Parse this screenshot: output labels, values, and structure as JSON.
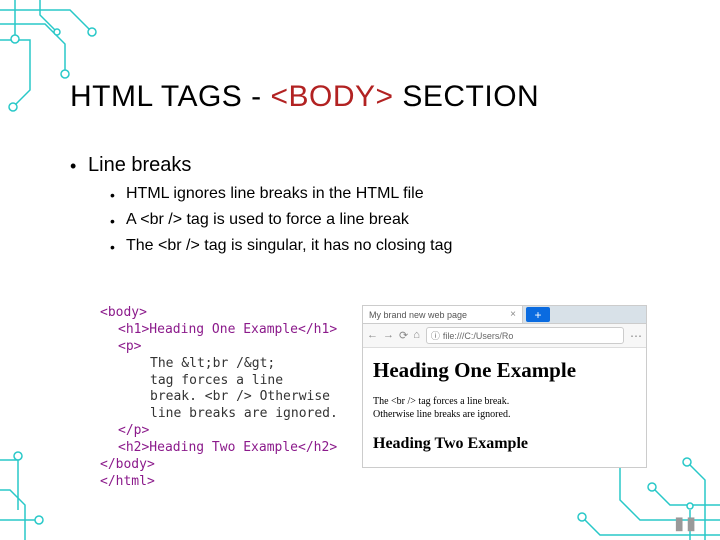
{
  "title": {
    "pre": "HTML TAGS - ",
    "red": "<BODY>",
    "post": " SECTION"
  },
  "bullets": {
    "main": "Line breaks",
    "sub": [
      "HTML ignores line breaks in the HTML file",
      "A <br /> tag is used to force a line break",
      "The <br /> tag is singular, it has no closing tag"
    ]
  },
  "code": {
    "l1": "<body>",
    "l2": "<h1>Heading One Example</h1>",
    "l3": "<p>",
    "l4": "The &lt;br /&gt;",
    "l5": "tag forces a line",
    "l6": "break. <br /> Otherwise",
    "l7": "line breaks are ignored.",
    "l8": "</p>",
    "l9": "<h2>Heading Two Example</h2>",
    "l10": "</body>",
    "l11": "</html>"
  },
  "browser": {
    "tabTitle": "My brand new web page",
    "plus": "+",
    "nav": {
      "back": "←",
      "fwd": "→",
      "reload": "⟳",
      "home": "⌂"
    },
    "urlIcon": "ⓘ",
    "url": "file:///C:/Users/Ro",
    "menu": "⋯",
    "h1": "Heading One Example",
    "para1": "The <br /> tag forces a line break.",
    "para2": "Otherwise line breaks are ignored.",
    "h2": "Heading Two Example"
  },
  "pause": "▮▮"
}
